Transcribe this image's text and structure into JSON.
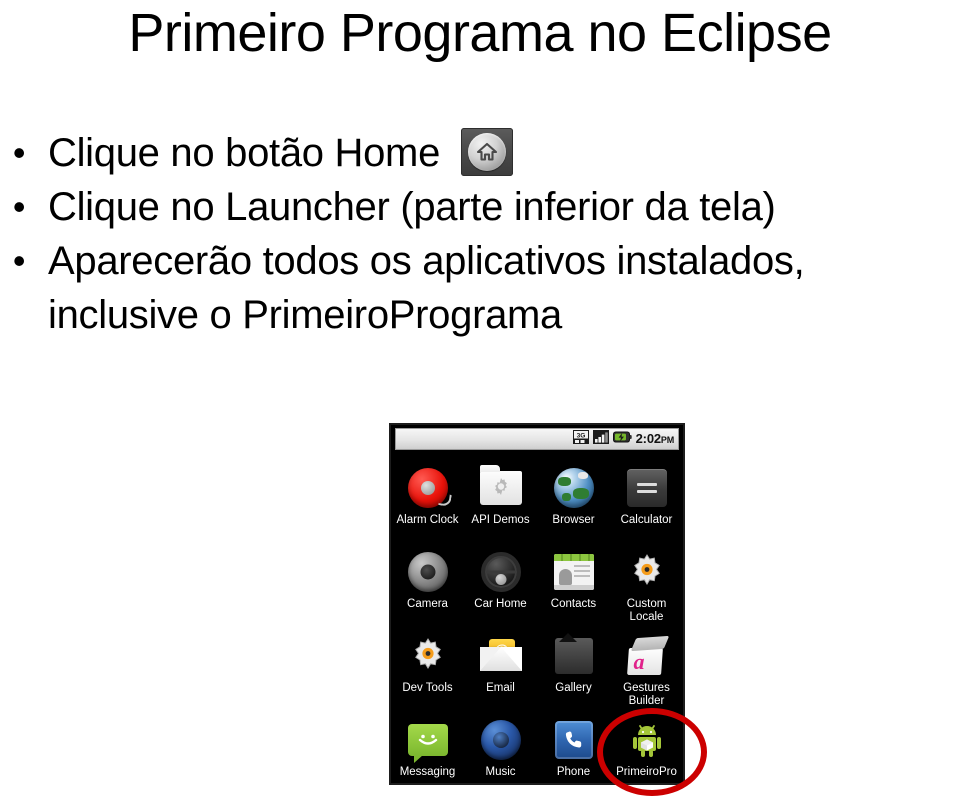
{
  "slide": {
    "title": "Primeiro Programa no Eclipse",
    "bullets": [
      {
        "text_before": "Clique no botão Home ",
        "icon": "home-button-icon",
        "text_after": ""
      },
      {
        "text_before": "Clique no Launcher (parte inferior da tela)",
        "icon": null,
        "text_after": ""
      },
      {
        "text_before": "Aparecerão todos os aplicativos instalados, inclusive o PrimeiroPrograma",
        "icon": null,
        "text_after": ""
      }
    ],
    "bullet_marker": "•"
  },
  "phone": {
    "status_bar": {
      "network_icon": "3g-icon",
      "network_label": "3G",
      "signal_icon": "signal-bars-icon",
      "battery_icon": "battery-charging-icon",
      "time": "2:02",
      "ampm": "PM"
    },
    "launcher": {
      "apps": [
        {
          "label": "Alarm Clock",
          "icon": "alarm-clock-icon"
        },
        {
          "label": "API Demos",
          "icon": "folder-gear-icon"
        },
        {
          "label": "Browser",
          "icon": "globe-icon"
        },
        {
          "label": "Calculator",
          "icon": "calculator-icon"
        },
        {
          "label": "Camera",
          "icon": "camera-lens-icon"
        },
        {
          "label": "Car Home",
          "icon": "steering-wheel-icon"
        },
        {
          "label": "Contacts",
          "icon": "contacts-card-icon"
        },
        {
          "label": "Custom Locale",
          "icon": "gear-orange-icon"
        },
        {
          "label": "Dev Tools",
          "icon": "gear-orange-icon"
        },
        {
          "label": "Email",
          "icon": "envelope-at-icon"
        },
        {
          "label": "Gallery",
          "icon": "photo-frame-icon"
        },
        {
          "label": "Gestures Builder",
          "icon": "gesture-pad-icon"
        },
        {
          "label": "Messaging",
          "icon": "speech-bubble-smile-icon"
        },
        {
          "label": "Music",
          "icon": "speaker-icon"
        },
        {
          "label": "Phone",
          "icon": "phone-handset-icon"
        },
        {
          "label": "PrimeiroPro",
          "icon": "android-robot-icon"
        }
      ]
    },
    "annotation": {
      "shape": "ellipse",
      "color": "#cc0000",
      "targets": "PrimeiroPro"
    }
  },
  "colors": {
    "background": "#ffffff",
    "text": "#000000",
    "annotation_red": "#cc0000",
    "phone_screen": "#000000",
    "status_bar": "#e6e6e6"
  }
}
